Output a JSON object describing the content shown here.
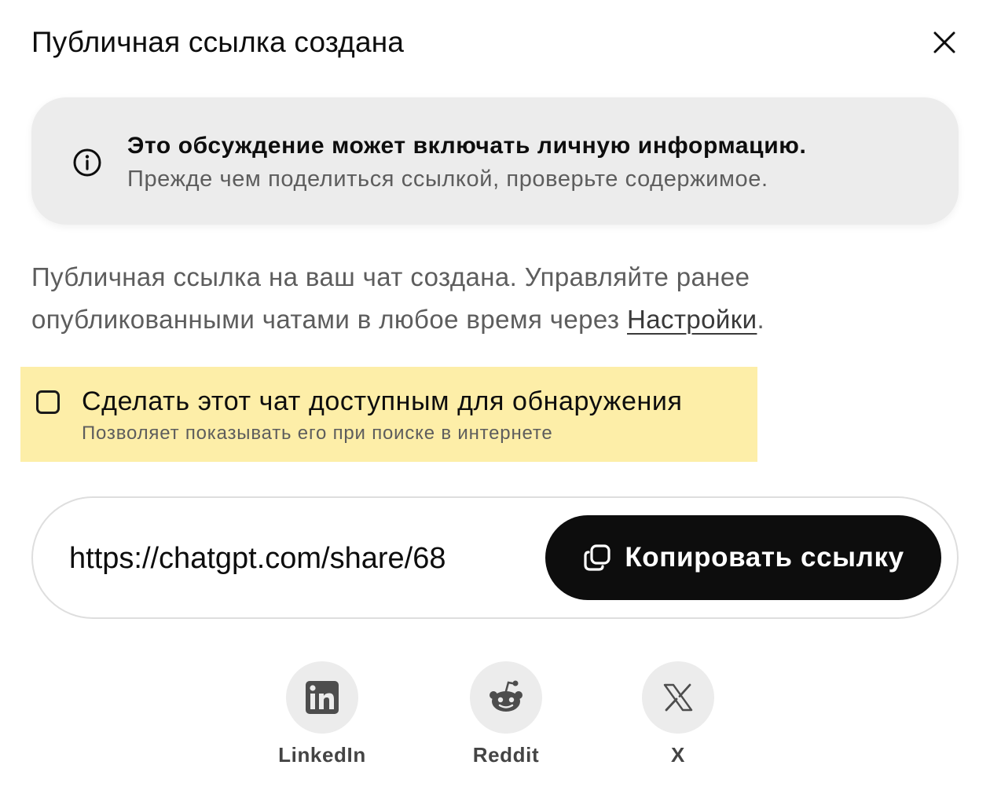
{
  "dialog": {
    "title": "Публичная ссылка создана",
    "close_icon": "close-icon"
  },
  "warning": {
    "icon": "info-icon",
    "title": "Это обсуждение может включать личную информацию.",
    "subtitle": "Прежде чем поделиться ссылкой, проверьте содержимое."
  },
  "description": {
    "text": "Публичная ссылка на ваш чат создана. Управляйте ранее опубликованными чатами в любое время через ",
    "link": "Настройки",
    "suffix": "."
  },
  "discoverable": {
    "checked": false,
    "label": "Сделать этот чат доступным для обнаружения",
    "sublabel": "Позволяет показывать его при поиске в интернете",
    "highlight_color": "#fdeea8"
  },
  "share": {
    "url": "https://chatgpt.com/share/68",
    "copy_label": "Копировать ссылку",
    "copy_icon": "copy-icon"
  },
  "social": [
    {
      "name": "linkedin",
      "label": "LinkedIn",
      "icon": "linkedin-icon"
    },
    {
      "name": "reddit",
      "label": "Reddit",
      "icon": "reddit-icon"
    },
    {
      "name": "x",
      "label": "X",
      "icon": "x-icon"
    }
  ],
  "colors": {
    "button_bg": "#0d0d0d",
    "card_bg": "#ececec",
    "muted_text": "#5d5d5d"
  }
}
